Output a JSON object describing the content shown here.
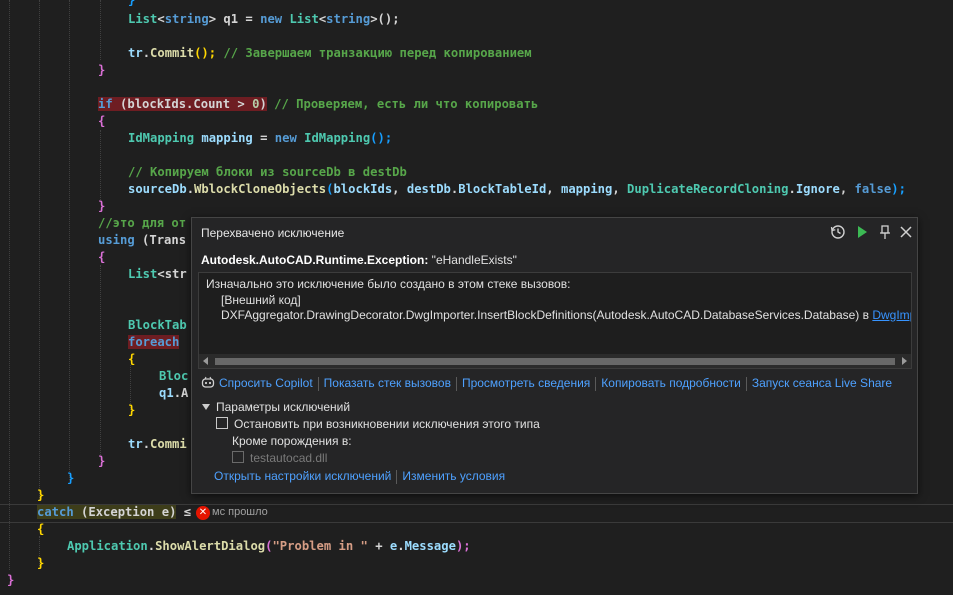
{
  "code": {
    "l1": {
      "close": "}"
    },
    "l2": {
      "t1": "List",
      "t2": "<",
      "t3": "string",
      "t4": "> q1 = ",
      "t5": "new",
      "t6": " List",
      "t7": "<",
      "t8": "string",
      "t9": ">();"
    },
    "l3": {
      "t1": "tr",
      "t2": ".",
      "t3": "Commit",
      "t4": "(); ",
      "t5": "// Завершаем транзакцию перед копированием"
    },
    "l4": {
      "close": "}"
    },
    "l5": {
      "t1": "if",
      "t2": " (blockIds.Count > ",
      "t3": "0",
      "t4": ")",
      "t5": " // Проверяем, есть ли что копировать"
    },
    "l6": {
      "open": "{"
    },
    "l7": {
      "t1": "IdMapping",
      "t2": " mapping",
      "t3": " = ",
      "t4": "new",
      "t5": " IdMapping",
      "t6": "();"
    },
    "l8": {
      "t1": "// Копируем блоки из sourceDb в destDb"
    },
    "l9": {
      "t1": "sourceDb",
      "t2": ".",
      "t3": "WblockCloneObjects",
      "t4": "(",
      "t5": "blockIds",
      "t6": ", ",
      "t7": "destDb",
      "t8": ".",
      "t9": "BlockTableId",
      "t10": ", ",
      "t11": "mapping",
      "t12": ", ",
      "t13": "DuplicateRecordCloning",
      "t14": ".",
      "t15": "Ignore",
      "t16": ", ",
      "t17": "false",
      "t18": ");"
    },
    "l10": {
      "close": "}"
    },
    "l11": {
      "t1": "//это для от"
    },
    "l12": {
      "t1": "using",
      "t2": " (Trans"
    },
    "l13": {
      "open": "{"
    },
    "l14": {
      "t1": "List",
      "t2": "<str"
    },
    "l15": {
      "t1": "BlockTab"
    },
    "l16": {
      "t1": "foreach"
    },
    "l17": {
      "open": "{"
    },
    "l18": {
      "t1": "Bloc"
    },
    "l19": {
      "t1": "q1",
      "t2": ".A"
    },
    "l20": {
      "close": "}"
    },
    "l21": {
      "t1": "tr",
      "t2": ".",
      "t3": "Commi"
    },
    "l22": {
      "close": "}"
    },
    "l23": {
      "close": "}"
    },
    "l24": {
      "close": "}"
    },
    "l25": {
      "t1": "catch",
      "t2": " (Exception e)",
      "t3": " ≤"
    },
    "l26": {
      "open": "{"
    },
    "l27": {
      "t1": "Application",
      "t2": ".",
      "t3": "ShowAlertDialog",
      "t4": "(",
      "t5": "\"Problem in \"",
      "t6": " + ",
      "t7": "e",
      "t8": ".",
      "t9": "Message",
      "t10": ");"
    },
    "l28": {
      "close": "}"
    },
    "l29": {
      "close": "}"
    }
  },
  "elapsed": "мс прошло",
  "error_badge": "✕",
  "exception_popup": {
    "title": "Перехвачено исключение",
    "exception_type": "Autodesk.AutoCAD.Runtime.Exception:",
    "exception_message": " \"eHandleExists\"",
    "stack_intro": "Изначально это исключение было создано в этом стеке вызовов:",
    "stack_line1": "[Внешний код]",
    "stack_line2": "DXFAggregator.DrawingDecorator.DwgImporter.InsertBlockDefinitions(Autodesk.AutoCAD.DatabaseServices.Database) в ",
    "stack_link": "DwgImport",
    "actions": {
      "ask_copilot": "Спросить Copilot",
      "show_call_stack": "Показать стек вызовов",
      "view_details": "Просмотреть сведения",
      "copy_details": "Копировать подробности",
      "live_share": "Запуск сеанса Live Share"
    },
    "exception_settings_header": "Параметры исключений",
    "break_when_thrown": "Остановить при возникновении исключения этого типа",
    "except_when_thrown_from": "Кроме порождения в:",
    "module_name": "testautocad.dll",
    "open_exception_settings": "Открыть настройки исключений",
    "edit_conditions": "Изменить условия"
  },
  "colors": {
    "link": "#3794ff",
    "error": "#e51400",
    "background": "#1f1f1f"
  }
}
